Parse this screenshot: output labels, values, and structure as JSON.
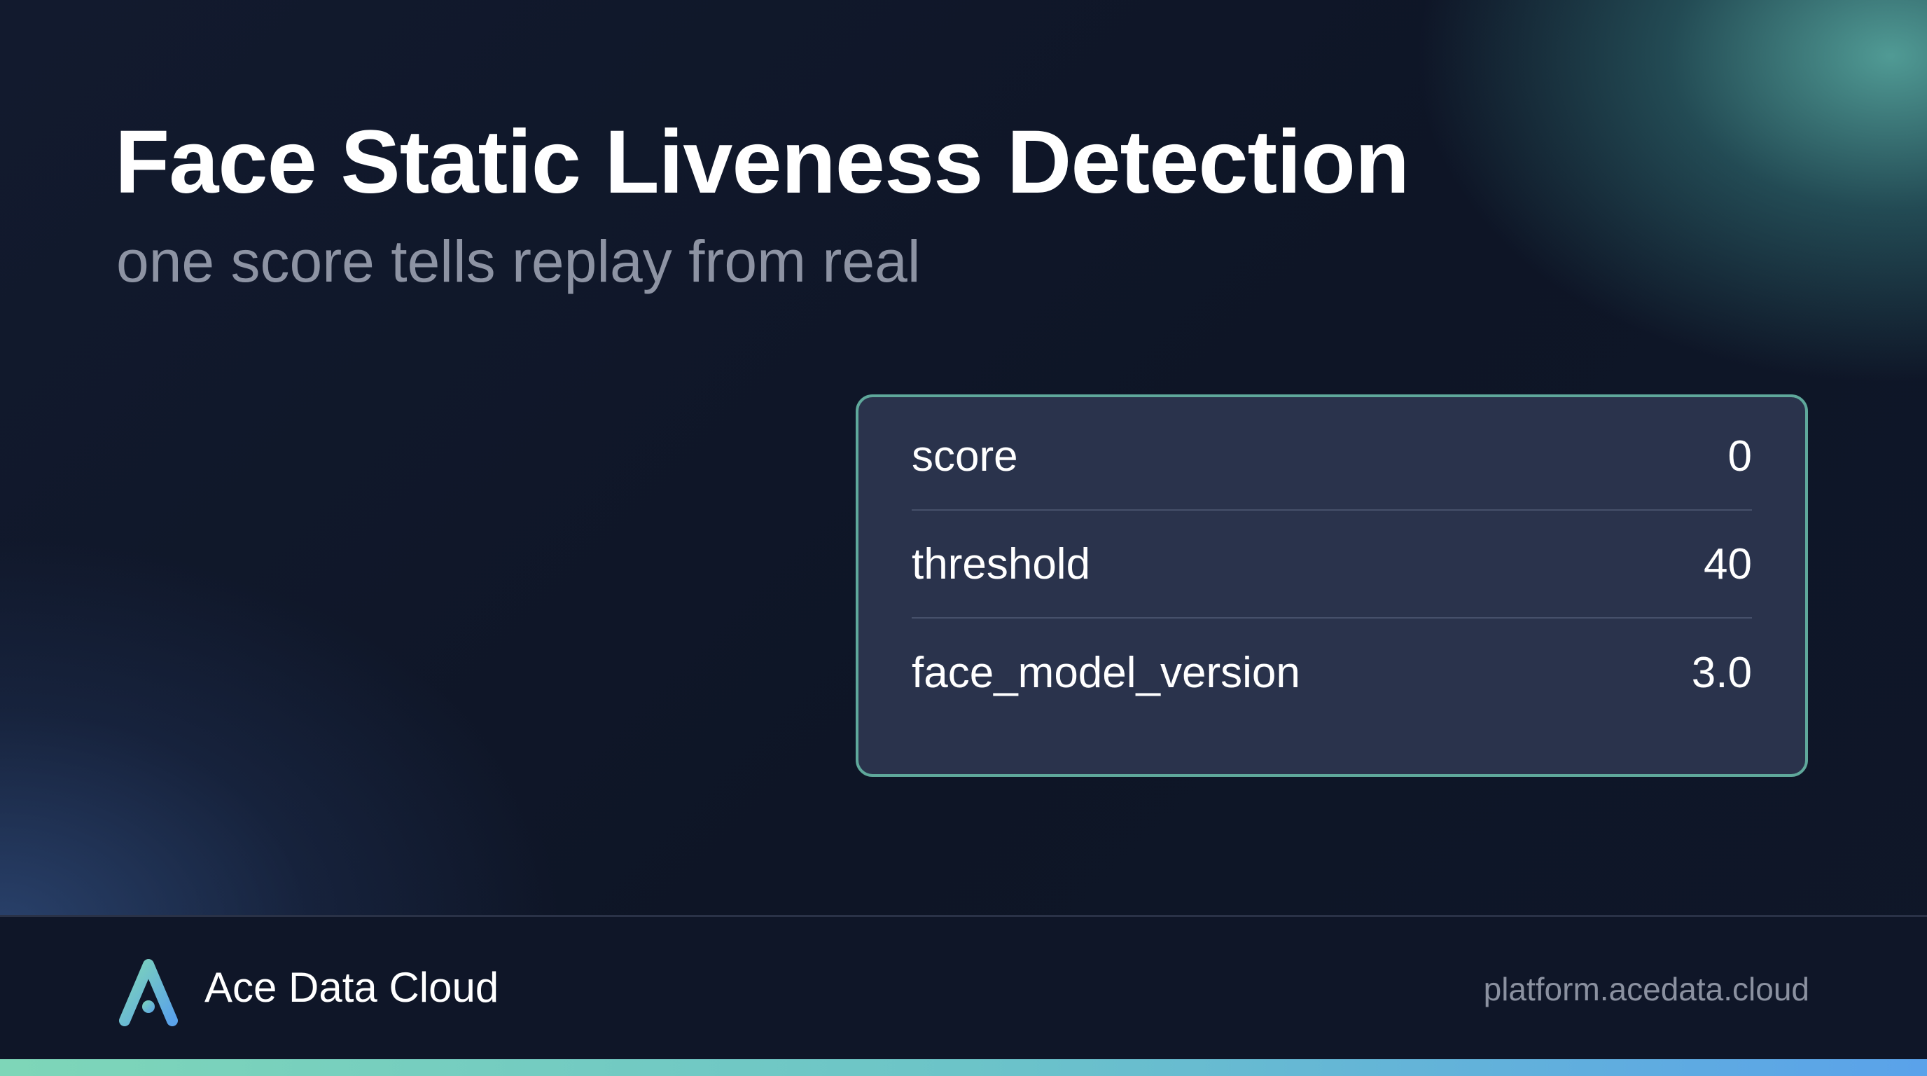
{
  "slide": {
    "title": "Face Static Liveness Detection",
    "subtitle": "one score tells replay from real"
  },
  "result_card": {
    "rows": [
      {
        "key": "score",
        "value": "0"
      },
      {
        "key": "threshold",
        "value": "40"
      },
      {
        "key": "face_model_version",
        "value": "3.0"
      }
    ]
  },
  "footer": {
    "brand_name": "Ace Data Cloud",
    "url": "platform.acedata.cloud",
    "logo_icon": "ace-data-cloud-logo-icon"
  },
  "colors": {
    "background": "#0f1628",
    "card_background": "#2a334c",
    "card_border": "#5fa89b",
    "accent_start": "#7ed6b8",
    "accent_end": "#5aa2ea",
    "subtitle": "#8d93a3"
  }
}
